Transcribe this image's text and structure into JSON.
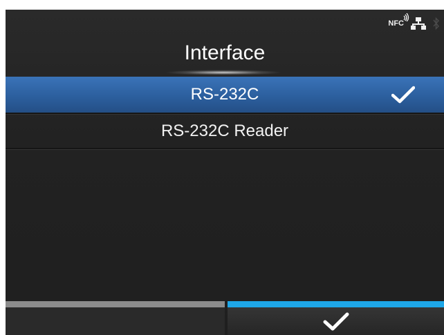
{
  "status_bar": {
    "nfc_label": "NFC",
    "icons": [
      "nfc-icon",
      "wired-network-icon",
      "bluetooth-icon"
    ]
  },
  "header": {
    "title": "Interface"
  },
  "menu": {
    "items": [
      {
        "label": "RS-232C",
        "selected": true,
        "checked": true
      },
      {
        "label": "RS-232C Reader",
        "selected": false,
        "checked": false
      }
    ]
  },
  "softkeys": {
    "left": {
      "icon": ""
    },
    "right": {
      "icon": "checkmark-icon"
    }
  },
  "colors": {
    "selection": "#2c5f9e",
    "softkey_left_bar": "#8c8c8c",
    "softkey_right_bar": "#1ea7e8",
    "background": "#222222"
  }
}
